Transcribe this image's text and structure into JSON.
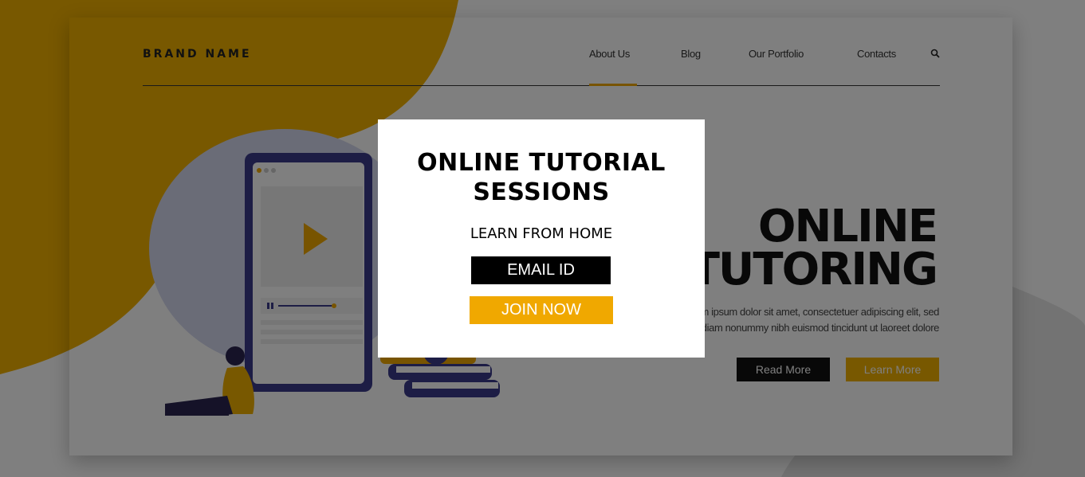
{
  "header": {
    "brand": "BRAND NAME",
    "nav": [
      "About Us",
      "Blog",
      "Our Portfolio",
      "Contacts"
    ],
    "active_nav": "About Us",
    "search_icon": "search-icon"
  },
  "hero": {
    "title_line1": "ONLINE",
    "title_line2": "TUTORING",
    "text_line1": "Lorem ipsum dolor sit amet, consectetuer adipiscing elit, sed",
    "text_line2": "diam nonummy nibh euismod tincidunt ut laoreet dolore",
    "read_more": "Read More",
    "learn_more": "Learn More"
  },
  "modal": {
    "title": "ONLINE TUTORIAL SESSIONS",
    "subtitle": "LEARN FROM HOME",
    "email_placeholder": "EMAIL ID",
    "join_label": "JOIN NOW"
  },
  "colors": {
    "accent": "#f0a800",
    "illustration": "#3b3a8a",
    "overlay": "rgba(0,0,0,0.5)"
  }
}
